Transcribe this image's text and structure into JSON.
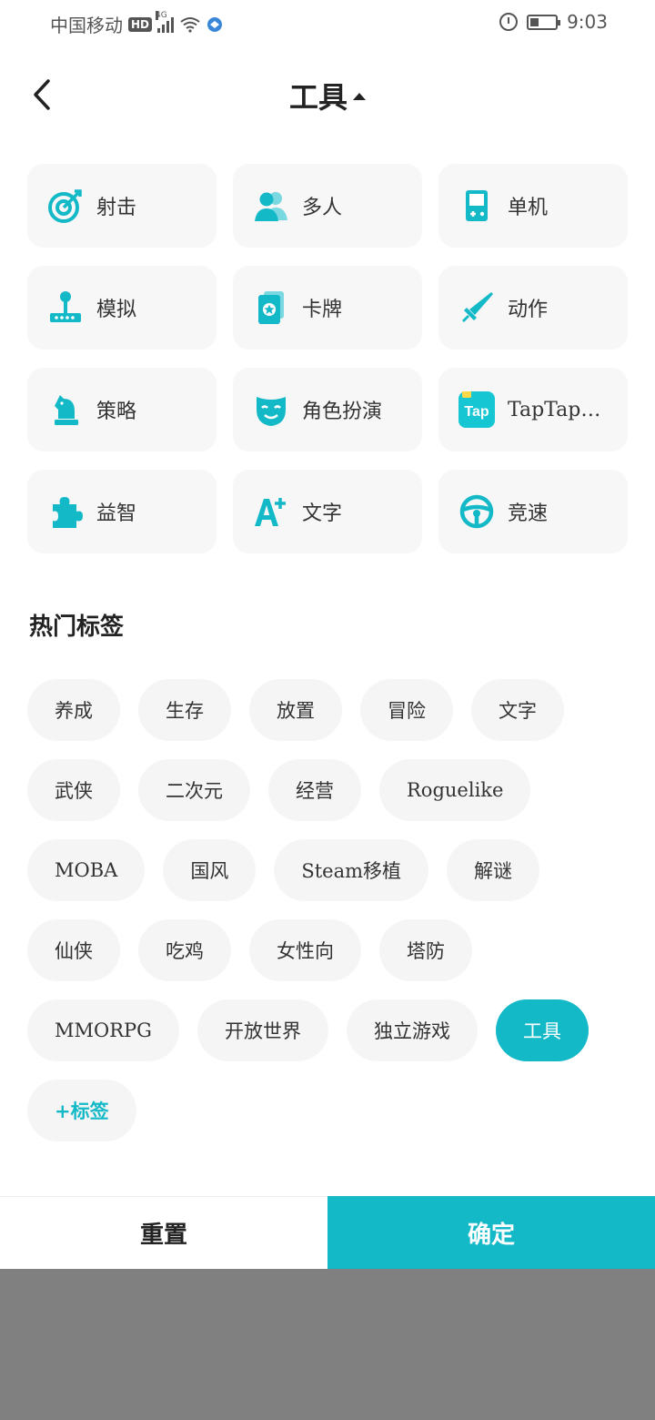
{
  "status_bar": {
    "carrier": "中国移动",
    "hd": "HD",
    "network": "4G",
    "time": "9:03"
  },
  "header": {
    "title": "工具"
  },
  "categories": [
    {
      "label": "射击",
      "icon": "target-icon"
    },
    {
      "label": "多人",
      "icon": "users-icon"
    },
    {
      "label": "单机",
      "icon": "handheld-console-icon"
    },
    {
      "label": "模拟",
      "icon": "joystick-icon"
    },
    {
      "label": "卡牌",
      "icon": "cards-icon"
    },
    {
      "label": "动作",
      "icon": "sword-icon"
    },
    {
      "label": "策略",
      "icon": "chess-knight-icon"
    },
    {
      "label": "角色扮演",
      "icon": "mask-icon"
    },
    {
      "label": "TapTap…",
      "icon": "taptap-logo-icon",
      "logo_text": "Tap"
    },
    {
      "label": "益智",
      "icon": "puzzle-icon"
    },
    {
      "label": "文字",
      "icon": "text-plus-icon",
      "icon_text": "A+"
    },
    {
      "label": "竞速",
      "icon": "steering-wheel-icon"
    }
  ],
  "hot_tags": {
    "title": "热门标签",
    "tags": [
      {
        "label": "养成",
        "selected": false
      },
      {
        "label": "生存",
        "selected": false
      },
      {
        "label": "放置",
        "selected": false
      },
      {
        "label": "冒险",
        "selected": false
      },
      {
        "label": "文字",
        "selected": false
      },
      {
        "label": "武侠",
        "selected": false
      },
      {
        "label": "二次元",
        "selected": false
      },
      {
        "label": "经营",
        "selected": false
      },
      {
        "label": "Roguelike",
        "selected": false
      },
      {
        "label": "MOBA",
        "selected": false
      },
      {
        "label": "国风",
        "selected": false
      },
      {
        "label": "Steam移植",
        "selected": false
      },
      {
        "label": "解谜",
        "selected": false
      },
      {
        "label": "仙侠",
        "selected": false
      },
      {
        "label": "吃鸡",
        "selected": false
      },
      {
        "label": "女性向",
        "selected": false
      },
      {
        "label": "塔防",
        "selected": false
      },
      {
        "label": "MMORPG",
        "selected": false
      },
      {
        "label": "开放世界",
        "selected": false
      },
      {
        "label": "独立游戏",
        "selected": false
      },
      {
        "label": "工具",
        "selected": true
      }
    ],
    "add_label": "+标签"
  },
  "buttons": {
    "reset": "重置",
    "confirm": "确定"
  },
  "colors": {
    "accent": "#14b9c8",
    "card_bg": "#f7f7f7",
    "overlay": "#808080"
  }
}
